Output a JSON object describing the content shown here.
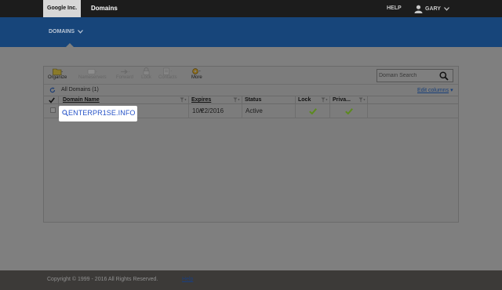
{
  "header": {
    "brand": "Google Inc.",
    "product": "Domains",
    "help": "HELP",
    "user": "GARY"
  },
  "nav": {
    "tab": "DOMAINS"
  },
  "toolbar": {
    "items": [
      {
        "label": "Organize",
        "icon": "folder-icon",
        "enabled": true
      },
      {
        "label": "Nameservers",
        "icon": "server-icon",
        "enabled": false
      },
      {
        "label": "Forward",
        "icon": "forward-icon",
        "enabled": false
      },
      {
        "label": "Lock",
        "icon": "lock-icon",
        "enabled": false
      },
      {
        "label": "Contacts",
        "icon": "contacts-icon",
        "enabled": false
      },
      {
        "label": "More",
        "icon": "gear-icon",
        "enabled": true
      }
    ],
    "search_placeholder": "Domain Search"
  },
  "list": {
    "title": "All Domains (1)",
    "edit_columns": "Edit columns"
  },
  "table": {
    "columns": [
      "Domain Name",
      "Expires",
      "Status",
      "Lock",
      "Priva..."
    ],
    "rows": [
      {
        "domain": "ENTERPR1SE.INFO",
        "expires": "10/22/2016",
        "status": "Active",
        "lock": "check",
        "privacy": "check"
      }
    ]
  },
  "footer": {
    "copyright": "Copyright © 1999 - 2016 All Rights Reserved.",
    "help_link": "Help"
  },
  "colors": {
    "overlay_gray": "#7f7f7f",
    "brand_blue": "#17457a",
    "link_blue": "#2754c8",
    "check_green": "#5c8a1e"
  }
}
